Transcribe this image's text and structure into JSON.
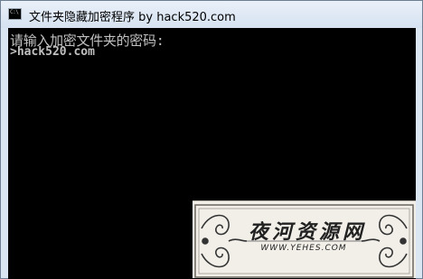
{
  "window": {
    "title": "文件夹隐藏加密程序 by hack520.com",
    "icon": "console-window-icon",
    "icon_text": "C:\\"
  },
  "console": {
    "prompt_line": "请输入加密文件夹的密码:",
    "input_line": ">hack520.com",
    "background_color": "#000000",
    "text_color": "#c0c0c0"
  },
  "watermark": {
    "title": "夜河资源网",
    "url": "WWW.YEHES.COM"
  }
}
